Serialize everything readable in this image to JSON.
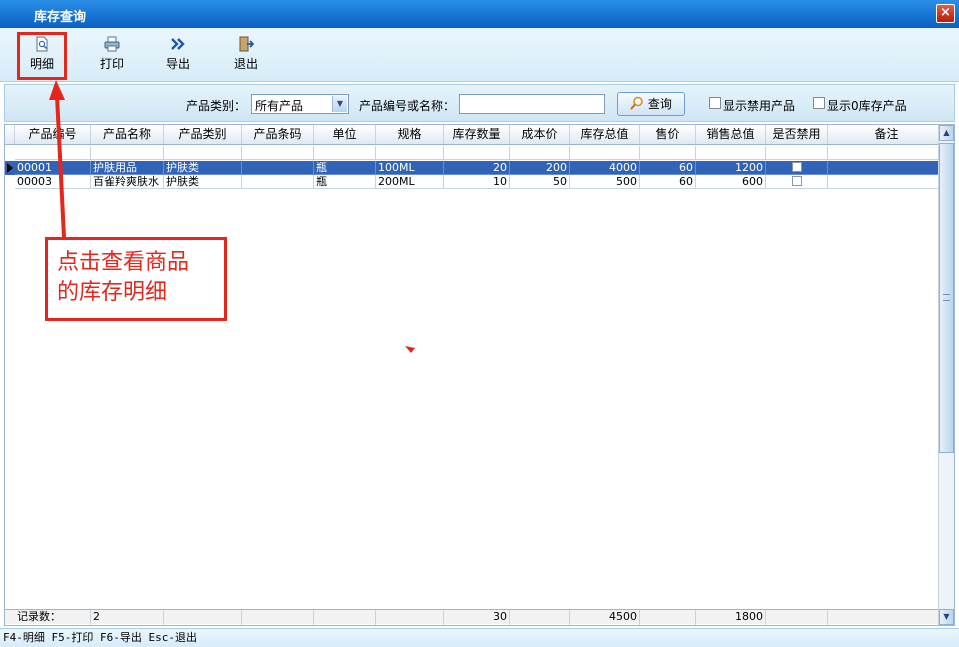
{
  "window": {
    "title": "库存查询",
    "close_label": "×"
  },
  "toolbar": {
    "detail_label": "明细",
    "print_label": "打印",
    "export_label": "导出",
    "exit_label": "退出"
  },
  "filter": {
    "category_label": "产品类别：",
    "category_value": "所有产品",
    "code_name_label": "产品编号或名称：",
    "code_name_value": "",
    "search_label": "查询",
    "show_disabled_label": "显示禁用产品",
    "show_zero_stock_label": "显示0库存产品"
  },
  "table": {
    "columns": [
      "产品编号",
      "产品名称",
      "产品类别",
      "产品条码",
      "单位",
      "规格",
      "库存数量",
      "成本价",
      "库存总值",
      "售价",
      "销售总值",
      "是否禁用",
      "备注"
    ],
    "rows": [
      {
        "code": "00001",
        "name": "护肤用品",
        "category": "护肤类",
        "barcode": "",
        "unit": "瓶",
        "spec": "100ML",
        "qty": "20",
        "cost": "200",
        "stock_total": "4000",
        "price": "60",
        "sales_total": "1200",
        "disabled": false,
        "remark": ""
      },
      {
        "code": "00003",
        "name": "百雀羚爽肤水",
        "category": "护肤类",
        "barcode": "",
        "unit": "瓶",
        "spec": "200ML",
        "qty": "10",
        "cost": "50",
        "stock_total": "500",
        "price": "60",
        "sales_total": "600",
        "disabled": false,
        "remark": ""
      }
    ],
    "footer": {
      "count_label": "记录数：",
      "count": "2",
      "qty_total": "30",
      "stock_total": "4500",
      "sales_total": "1800"
    }
  },
  "statusbar": {
    "text": "F4-明细 F5-打印 F6-导出 Esc-退出"
  },
  "annotation": {
    "line1": "点击查看商品",
    "line2": "的库存明细",
    "color": "#e6261a"
  },
  "colors": {
    "titlebar": "#0a5fc4",
    "selected_row": "#3164b9"
  }
}
